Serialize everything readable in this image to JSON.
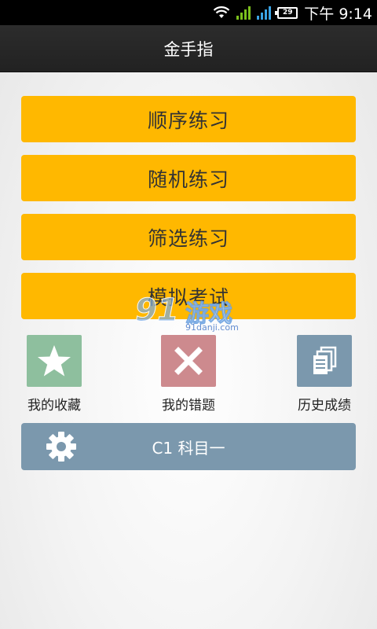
{
  "status_bar": {
    "time": "下午 9:14",
    "battery": "29"
  },
  "header": {
    "title": "金手指"
  },
  "menu": [
    {
      "label": "顺序练习"
    },
    {
      "label": "随机练习"
    },
    {
      "label": "筛选练习"
    },
    {
      "label": "模拟考试"
    }
  ],
  "tiles": [
    {
      "label": "我的收藏",
      "icon": "star-icon",
      "color": "#8ebf9e"
    },
    {
      "label": "我的错题",
      "icon": "close-icon",
      "color": "#cd8a8e"
    },
    {
      "label": "历史成绩",
      "icon": "documents-icon",
      "color": "#7b98ad"
    }
  ],
  "subject": {
    "label": "C1 科目一",
    "icon": "gear-icon"
  },
  "watermark": {
    "number": "91",
    "text": "游戏",
    "url": "91danji.com"
  },
  "colors": {
    "menu_button": "#ffb800",
    "subject_button": "#7b98ad",
    "header": "#262626"
  }
}
